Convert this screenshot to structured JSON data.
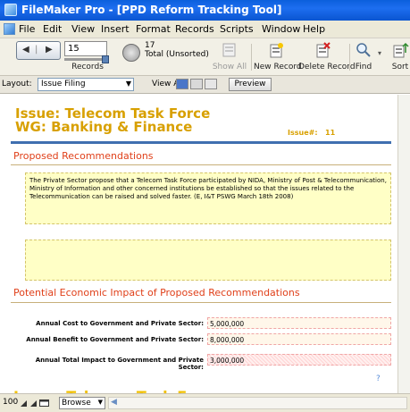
{
  "window": {
    "title": "FileMaker Pro - [PPD Reform Tracking Tool]"
  },
  "menu": [
    "File",
    "Edit",
    "View",
    "Insert",
    "Format",
    "Records",
    "Scripts",
    "Window",
    "Help"
  ],
  "toolbar": {
    "record_number": "15",
    "records_label": "Records",
    "total_count": "17",
    "total_label": "Total (Unsorted)",
    "show_all": "Show All",
    "new_record": "New Record",
    "delete_record": "Delete Record",
    "find": "Find",
    "sort": "Sort"
  },
  "layoutbar": {
    "layout_label": "Layout:",
    "layout_value": "Issue Filing",
    "view_as_label": "View As:",
    "preview": "Preview"
  },
  "record": {
    "issue_heading": "Issue: Telecom Task Force",
    "wg_heading": "WG: Banking & Finance",
    "issue_num_label": "Issue#:",
    "issue_num": "11",
    "proposed_title": "Proposed Recommendations",
    "recommendation_text": "The Private Sector propose that a Telecom Task Force participated by NIDA, Ministry of Post & Telecommunication, Ministry of Information and other concerned institutions be established so that the issues related to the Telecommunication can be raised and solved faster. (E, I&T PSWG March 18th 2008)",
    "impact_title": "Potential Economic Impact of Proposed Recommendations",
    "cost_label": "Annual Cost to Government and Private Sector:",
    "cost_value": "5,000,000",
    "benefit_label": "Annual Benefit to Government and Private Sector:",
    "benefit_value": "8,000,000",
    "total_label": "Annual Total Impact to Government and Private Sector:",
    "total_value": "3,000,000",
    "help_mark": "?"
  },
  "statusbar": {
    "zoom": "100",
    "mode": "Browse"
  },
  "colors": {
    "heading_gold": "#d8a000",
    "section_red": "#e0401a",
    "rule_blue": "#3f6fb0",
    "note_yellow": "#ffffc6"
  }
}
